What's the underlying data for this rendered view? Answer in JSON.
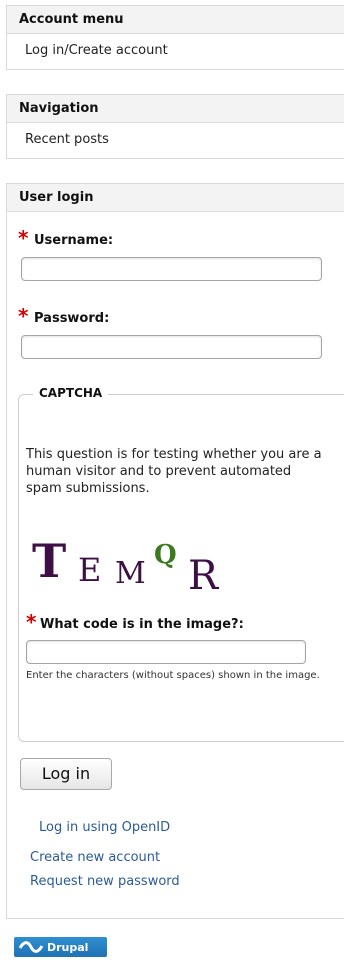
{
  "account_menu": {
    "title": "Account menu",
    "items": [
      "Log in/Create account"
    ]
  },
  "navigation": {
    "title": "Navigation",
    "items": [
      "Recent posts"
    ]
  },
  "user_login": {
    "title": "User login",
    "required_marker": "*",
    "username_label": "Username:",
    "password_label": "Password:",
    "captcha": {
      "legend": "CAPTCHA",
      "description": "This question is for testing whether you are a human visitor and to prevent automated spam submissions.",
      "image_text": "TEMQR",
      "question_label": "What code is in the image?:",
      "help_text": "Enter the characters (without spaces) shown in the image."
    },
    "login_button": "Log in",
    "openid_link": "Log in using OpenID",
    "create_account_link": "Create new account",
    "request_password_link": "Request new password"
  },
  "footer": {
    "badge_text": "Drupal"
  }
}
